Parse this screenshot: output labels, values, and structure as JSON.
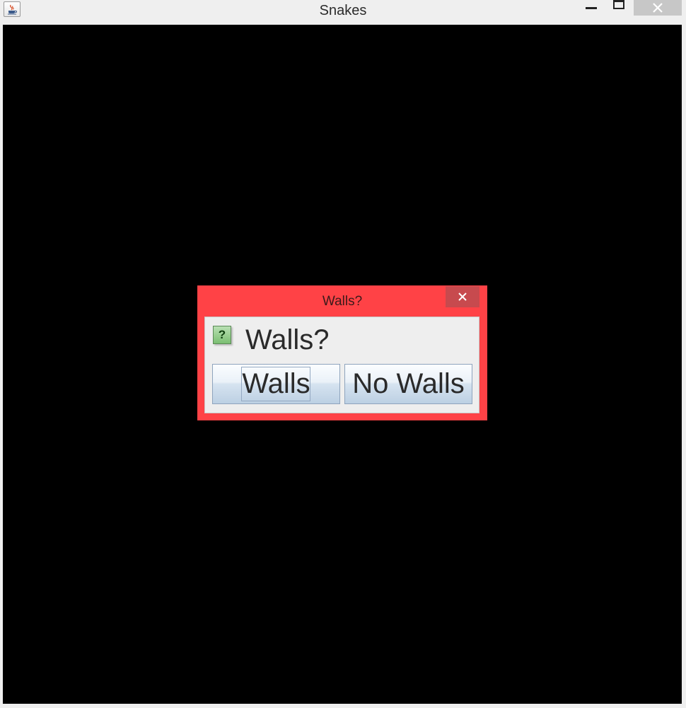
{
  "window": {
    "title": "Snakes",
    "app_icon": "java-icon"
  },
  "dialog": {
    "title": "Walls?",
    "message": "Walls?",
    "icon": "question-icon",
    "icon_glyph": "?",
    "buttons": [
      {
        "label": "Walls",
        "focused": true
      },
      {
        "label": "No Walls",
        "focused": false
      }
    ],
    "colors": {
      "frame": "#ff4246",
      "close_button": "#c74a4e"
    }
  },
  "game": {
    "background_color": "#000000"
  }
}
